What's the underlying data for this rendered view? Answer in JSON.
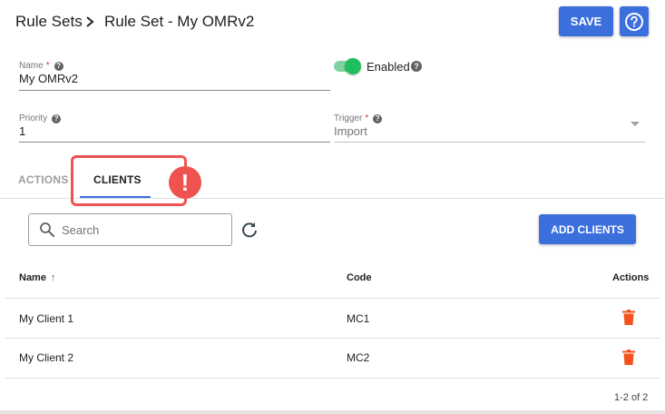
{
  "header": {
    "breadcrumb_root": "Rule Sets",
    "breadcrumb_current": "Rule Set - My OMRv2",
    "save_label": "SAVE"
  },
  "form": {
    "name_label": "Name",
    "name_value": "My OMRv2",
    "enabled_label": "Enabled",
    "enabled": true,
    "priority_label": "Priority",
    "priority_value": "1",
    "trigger_label": "Trigger",
    "trigger_value": "Import",
    "required_marker": "*"
  },
  "tabs": [
    {
      "label": "ACTIONS",
      "active": false
    },
    {
      "label": "CLIENTS",
      "active": true
    }
  ],
  "callout": {
    "glyph": "!"
  },
  "toolbar": {
    "search_placeholder": "Search",
    "add_label": "ADD CLIENTS"
  },
  "table": {
    "columns": {
      "name": "Name",
      "code": "Code",
      "actions": "Actions"
    },
    "sort_glyph": "↑",
    "rows": [
      {
        "name": "My Client 1",
        "code": "MC1"
      },
      {
        "name": "My Client 2",
        "code": "MC2"
      }
    ],
    "pagination": "1-2 of 2"
  },
  "colors": {
    "primary": "#3b6fdc",
    "toggle_on": "#1fbf5f",
    "delete": "#f4511e",
    "highlight": "#ef5350"
  },
  "icons": [
    "chevron-right-icon",
    "help-circle-icon",
    "help-icon",
    "dropdown-arrow-icon",
    "alert-icon",
    "search-icon",
    "refresh-icon",
    "sort-ascending-icon",
    "delete-icon"
  ]
}
